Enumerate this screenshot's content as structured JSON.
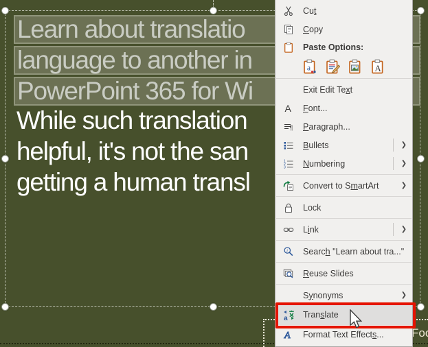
{
  "slide": {
    "background_color": "#47502c",
    "title_lines": [
      "Learn about translatio",
      "language to another in",
      "PowerPoint 365 for Wi"
    ],
    "body_lines": [
      "While such translation",
      "helpful, it's not the san",
      "getting a human transl"
    ],
    "footer_text": "Foo",
    "selection": {
      "highlight_fill": "#6c7154",
      "highlight_border": "#90957b",
      "selected_text_color": "#c9ccc3",
      "body_text_color": "#ffffff"
    }
  },
  "context_menu": {
    "background_color": "#f1f0ee",
    "hover_color": "#dfdedd",
    "items": [
      {
        "pre": "Cu",
        "accel": "t",
        "post": "",
        "icon": "scissors"
      },
      {
        "pre": "",
        "accel": "C",
        "post": "opy",
        "icon": "copy"
      },
      {
        "pre": "Exit Edit Te",
        "accel": "x",
        "post": "t",
        "icon": ""
      },
      {
        "pre": "",
        "accel": "F",
        "post": "ont...",
        "icon": "font"
      },
      {
        "pre": "",
        "accel": "P",
        "post": "aragraph...",
        "icon": "paragraph"
      },
      {
        "pre": "",
        "accel": "B",
        "post": "ullets",
        "icon": "bullets",
        "submenu": true
      },
      {
        "pre": "",
        "accel": "N",
        "post": "umbering",
        "icon": "numbering",
        "submenu": true
      },
      {
        "pre": "Convert to S",
        "accel": "m",
        "post": "artArt",
        "icon": "smartart",
        "submenu": true
      },
      {
        "pre": "L",
        "accel": "",
        "post": "ock",
        "icon": "lock"
      },
      {
        "pre": "L",
        "accel": "i",
        "post": "nk",
        "icon": "link",
        "submenu": true
      },
      {
        "pre": "Searc",
        "accel": "h",
        "post": " \"Learn about tra...\"",
        "icon": "search"
      },
      {
        "pre": "",
        "accel": "R",
        "post": "euse Slides",
        "icon": "reuse-slides"
      },
      {
        "pre": "S",
        "accel": "y",
        "post": "nonyms",
        "icon": "",
        "submenu": true
      },
      {
        "pre": "Tran",
        "accel": "s",
        "post": "late",
        "icon": "translate",
        "hovered": true
      },
      {
        "pre": "Format Text Effect",
        "accel": "s",
        "post": "...",
        "icon": "format-effects"
      }
    ],
    "paste_options": {
      "label": "Paste Options:",
      "button_icons": [
        "use-destination-theme",
        "keep-source-formatting",
        "picture",
        "keep-text-only"
      ]
    }
  },
  "annotation": {
    "highlight_box_color": "#e51400",
    "highlighted_item": "Translate"
  }
}
